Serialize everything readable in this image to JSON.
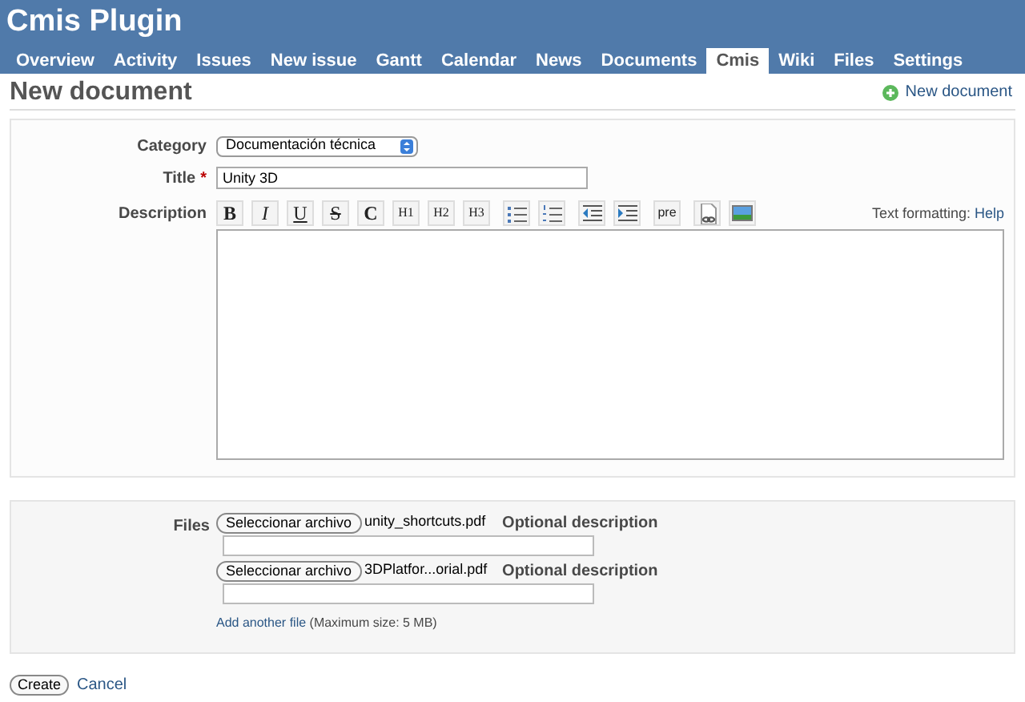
{
  "header": {
    "title": "Cmis Plugin"
  },
  "tabs": [
    {
      "label": "Overview",
      "selected": false
    },
    {
      "label": "Activity",
      "selected": false
    },
    {
      "label": "Issues",
      "selected": false
    },
    {
      "label": "New issue",
      "selected": false
    },
    {
      "label": "Gantt",
      "selected": false
    },
    {
      "label": "Calendar",
      "selected": false
    },
    {
      "label": "News",
      "selected": false
    },
    {
      "label": "Documents",
      "selected": false
    },
    {
      "label": "Cmis",
      "selected": true
    },
    {
      "label": "Wiki",
      "selected": false
    },
    {
      "label": "Files",
      "selected": false
    },
    {
      "label": "Settings",
      "selected": false
    }
  ],
  "page_title": "New document",
  "new_document_link": "New document",
  "form": {
    "category": {
      "label": "Category",
      "value": "Documentación técnica"
    },
    "title": {
      "label": "Title",
      "required_mark": "*",
      "value": "Unity 3D"
    },
    "description": {
      "label": "Description",
      "help_prefix": "Text formatting:",
      "help_link": "Help"
    }
  },
  "toolbar": [
    {
      "kind": "text",
      "label": "B"
    },
    {
      "kind": "text",
      "label": "I"
    },
    {
      "kind": "text",
      "label": "U"
    },
    {
      "kind": "text",
      "label": "S"
    },
    {
      "kind": "text",
      "label": "C"
    },
    {
      "kind": "text",
      "label": "H1"
    },
    {
      "kind": "text",
      "label": "H2"
    },
    {
      "kind": "text",
      "label": "H3"
    },
    {
      "kind": "bullets"
    },
    {
      "kind": "numbers"
    },
    {
      "kind": "outdent"
    },
    {
      "kind": "indent"
    },
    {
      "kind": "text",
      "label": "pre"
    },
    {
      "kind": "link"
    },
    {
      "kind": "image"
    }
  ],
  "files": {
    "label": "Files",
    "rows": [
      {
        "button": "Seleccionar archivo",
        "filename": "unity_shortcuts.pdf",
        "description_label": "Optional description"
      },
      {
        "button": "Seleccionar archivo",
        "filename": "3DPlatfor...orial.pdf",
        "description_label": "Optional description"
      }
    ],
    "add_link": "Add another file",
    "max_size": "(Maximum size: 5 MB)"
  },
  "buttons": {
    "create": "Create",
    "cancel": "Cancel"
  }
}
